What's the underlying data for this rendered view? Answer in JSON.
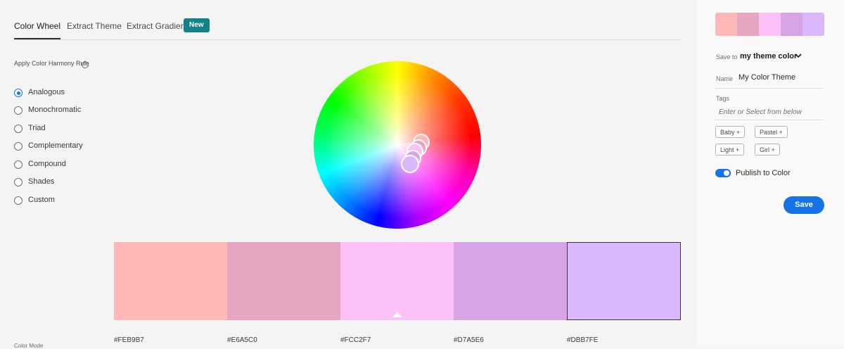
{
  "tabs": [
    {
      "label": "Color Wheel"
    },
    {
      "label": "Extract Theme"
    },
    {
      "label": "Extract Gradient"
    }
  ],
  "new_badge": "New",
  "harmony": {
    "label": "Apply Color Harmony Rule",
    "help_icon": "?",
    "rules": [
      "Analogous",
      "Monochromatic",
      "Triad",
      "Complementary",
      "Compound",
      "Shades",
      "Custom"
    ],
    "selected": "Analogous"
  },
  "swatches": [
    {
      "hex": "#FEB9B7",
      "color": "#feb9b7"
    },
    {
      "hex": "#E6A5C0",
      "color": "#e6a5c0"
    },
    {
      "hex": "#FCC2F7",
      "color": "#fcc2f7"
    },
    {
      "hex": "#D7A5E6",
      "color": "#d7a5e6"
    },
    {
      "hex": "#DBB7FE",
      "color": "#dbb7fe"
    }
  ],
  "base_swatch_index": 2,
  "color_mode_label": "Color Mode",
  "panel": {
    "save_to_label": "Save to",
    "save_to_value": "my theme color",
    "name_label": "Name",
    "name_value": "My Color Theme",
    "tags_label": "Tags",
    "tags_placeholder": "Enter or Select from below",
    "tags": [
      "Baby",
      "Pastel",
      "Light",
      "Girl"
    ],
    "tag_add_symbol": "+",
    "publish_label": "Publish to Color",
    "publish_on": true,
    "save_label": "Save"
  }
}
